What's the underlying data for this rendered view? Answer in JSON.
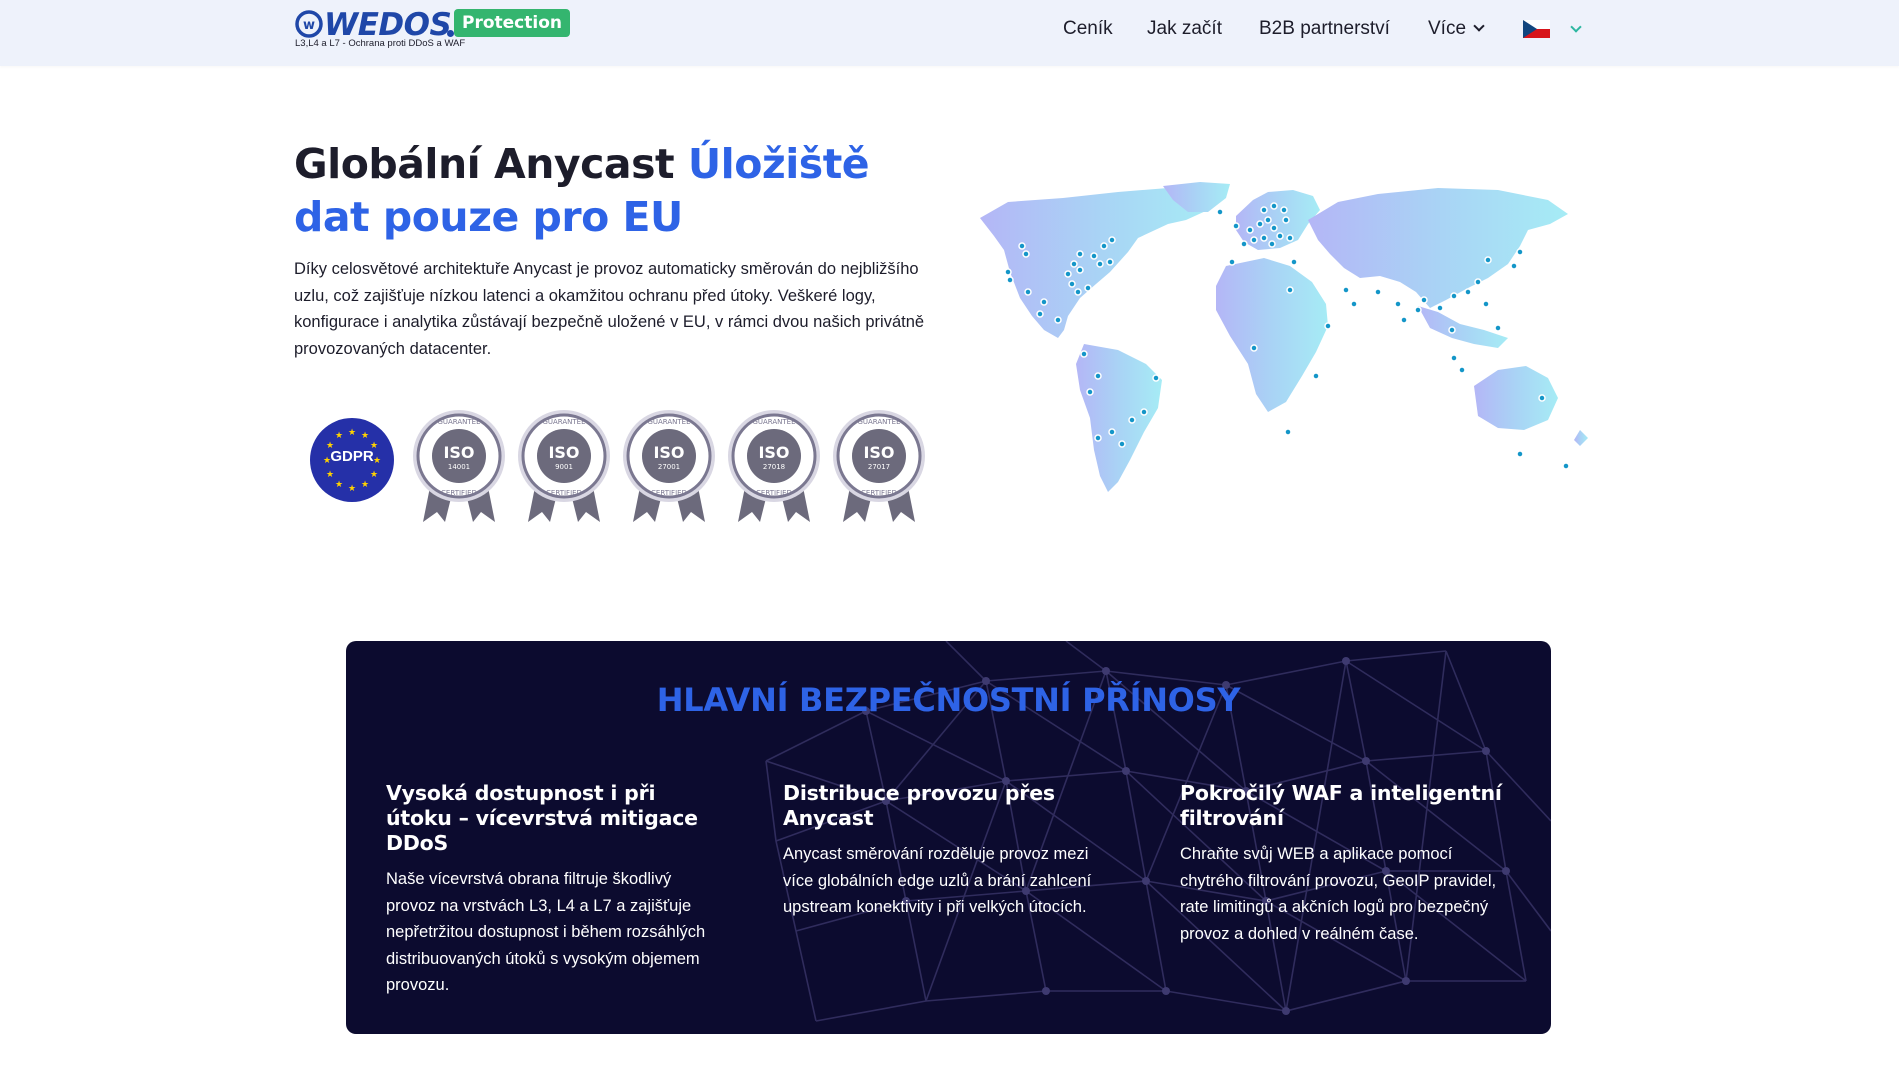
{
  "brand": {
    "name": "WEDOS",
    "badge": "Protection",
    "tagline": "L3,L4 a L7 - Ochrana proti DDoS a WAF",
    "color_primary": "#1f47a8",
    "color_badge": "#34b56f"
  },
  "nav": {
    "items": [
      {
        "label": "Ceník"
      },
      {
        "label": "Jak začít"
      },
      {
        "label": "B2B partnerství"
      },
      {
        "label": "Více"
      }
    ],
    "language": {
      "flag": "cz-flag-icon"
    }
  },
  "hero": {
    "title_plain": "Globální Anycast ",
    "title_accent": "Úložiště dat pouze pro EU",
    "description": "Díky celosvětové architektuře Anycast je provoz automaticky směrován do nejbližšího uzlu, což zajišťuje nízkou latenci a okamžitou ochranu před útoky. Veškeré logy, konfigurace i analytika zůstávají bezpečně uložené v EU, v rámci dvou našich privátně provozovaných datacenter.",
    "accent_color": "#2e63e6"
  },
  "certifications": {
    "gdpr": "GDPR",
    "iso": [
      {
        "label": "ISO",
        "number": "14001",
        "top": "GUARANTEE",
        "bottom": "CERTIFIED"
      },
      {
        "label": "ISO",
        "number": "9001",
        "top": "GUARANTEE",
        "bottom": "CERTIFIED"
      },
      {
        "label": "ISO",
        "number": "27001",
        "top": "GUARANTEE",
        "bottom": "CERTIFIED"
      },
      {
        "label": "ISO",
        "number": "27018",
        "top": "GUARANTEE",
        "bottom": "CERTIFIED"
      },
      {
        "label": "ISO",
        "number": "27017",
        "top": "GUARANTEE",
        "bottom": "CERTIFIED"
      }
    ]
  },
  "map": {
    "icon": "world-map-anycast-nodes",
    "node_color": "#1496c8"
  },
  "benefits": {
    "title": "HLAVNÍ BEZPEČNOSTNÍ PŘÍNOSY",
    "items": [
      {
        "title": "Vysoká dostupnost i při útoku – vícevrstvá mitigace DDoS",
        "text": "Naše vícevrstvá obrana filtruje škodlivý provoz na vrstvách L3, L4 a L7 a zajišťuje nepřetržitou dostupnost i během rozsáhlých distribuovaných útoků s vysokým objemem provozu."
      },
      {
        "title": "Distribuce provozu přes Anycast",
        "text": "Anycast směrování rozděluje provoz mezi více globálních edge uzlů a brání zahlcení upstream konektivity i při velkých útocích."
      },
      {
        "title": "Pokročilý WAF a inteligentní filtrování",
        "text": "Chraňte svůj WEB a aplikace pomocí chytrého filtrování provozu, GeoIP pravidel, rate limitingů a akčních logů pro bezpečný provoz a dohled v reálném čase."
      }
    ]
  }
}
